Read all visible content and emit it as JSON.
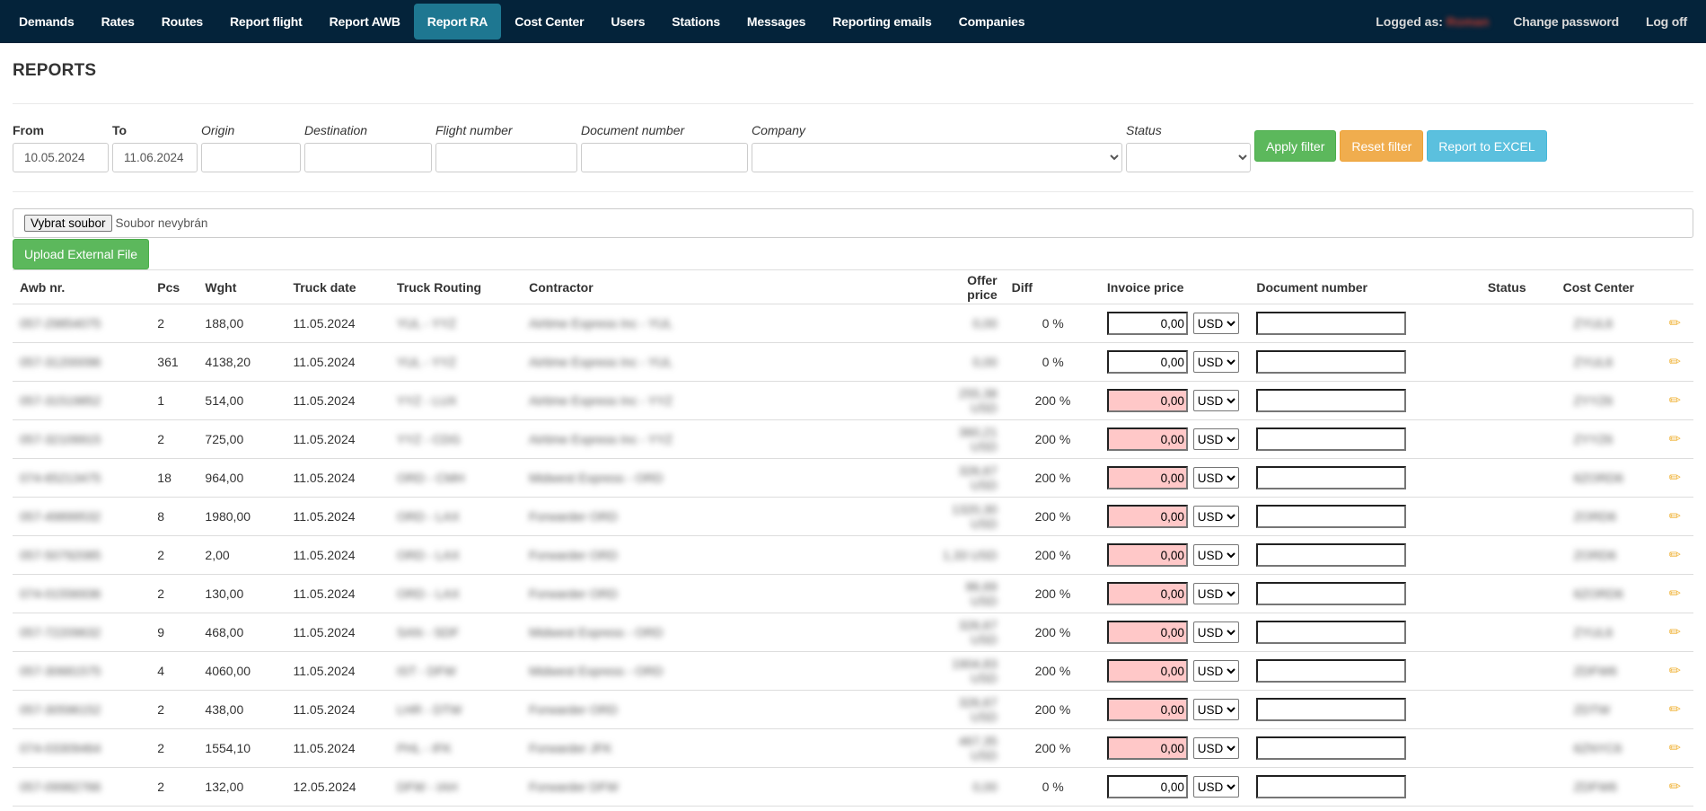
{
  "nav": {
    "items": [
      {
        "label": "Demands",
        "active": false
      },
      {
        "label": "Rates",
        "active": false
      },
      {
        "label": "Routes",
        "active": false
      },
      {
        "label": "Report flight",
        "active": false
      },
      {
        "label": "Report AWB",
        "active": false
      },
      {
        "label": "Report RA",
        "active": true
      },
      {
        "label": "Cost Center",
        "active": false
      },
      {
        "label": "Users",
        "active": false
      },
      {
        "label": "Stations",
        "active": false
      },
      {
        "label": "Messages",
        "active": false
      },
      {
        "label": "Reporting emails",
        "active": false
      },
      {
        "label": "Companies",
        "active": false
      }
    ],
    "logged_as_label": "Logged as:",
    "user_name": "Roman",
    "change_password": "Change password",
    "log_off": "Log off",
    "bg_color": "#04233a",
    "active_color": "#1e7791"
  },
  "page_title": "REPORTS",
  "filters": {
    "from_label": "From",
    "from_value": "10.05.2024",
    "to_label": "To",
    "to_value": "11.06.2024",
    "origin_label": "Origin",
    "origin_value": "",
    "destination_label": "Destination",
    "destination_value": "",
    "flight_label": "Flight number",
    "flight_value": "",
    "document_label": "Document number",
    "document_value": "",
    "company_label": "Company",
    "company_value": "",
    "status_label": "Status",
    "status_value": "",
    "apply": "Apply filter",
    "reset": "Reset filter",
    "excel": "Report to EXCEL"
  },
  "upload": {
    "choose_file": "Vybrat soubor",
    "no_file": "Soubor nevybrán",
    "upload_button": "Upload External File"
  },
  "table": {
    "headers": [
      "Awb nr.",
      "Pcs",
      "Wght",
      "Truck date",
      "Truck Routing",
      "Contractor",
      "Offer price",
      "Diff",
      "Invoice price",
      "Document number",
      "Status",
      "Cost Center"
    ],
    "rows": [
      {
        "awb": "057-29854075",
        "pcs": "2",
        "wght": "188,00",
        "date": "11.05.2024",
        "routing": "YUL - YYZ",
        "contractor": "Airtime Express Inc - YUL",
        "offer": "0,00",
        "diff": "0 %",
        "invoice": "0,00",
        "currency": "USD",
        "doc": "",
        "status": "",
        "cost_center": "ZYUL6",
        "flag": false
      },
      {
        "awb": "057-31200096",
        "pcs": "361",
        "wght": "4138,20",
        "date": "11.05.2024",
        "routing": "YUL - YYZ",
        "contractor": "Airtime Express Inc - YUL",
        "offer": "0,00",
        "diff": "0 %",
        "invoice": "0,00",
        "currency": "USD",
        "doc": "",
        "status": "",
        "cost_center": "ZYUL6",
        "flag": false
      },
      {
        "awb": "057-31519852",
        "pcs": "1",
        "wght": "514,00",
        "date": "11.05.2024",
        "routing": "YYZ - LUX",
        "contractor": "Airtime Express Inc - YYZ",
        "offer": "255,38 USD",
        "diff": "200 %",
        "invoice": "0,00",
        "currency": "USD",
        "doc": "",
        "status": "",
        "cost_center": "ZYYZ6",
        "flag": true
      },
      {
        "awb": "057-32109915",
        "pcs": "2",
        "wght": "725,00",
        "date": "11.05.2024",
        "routing": "YYZ - CDG",
        "contractor": "Airtime Express Inc - YYZ",
        "offer": "360,21 USD",
        "diff": "200 %",
        "invoice": "0,00",
        "currency": "USD",
        "doc": "",
        "status": "",
        "cost_center": "ZYYZ6",
        "flag": true
      },
      {
        "awb": "074-65213475",
        "pcs": "18",
        "wght": "964,00",
        "date": "11.05.2024",
        "routing": "ORD - CMH",
        "contractor": "Midwest Express - ORD",
        "offer": "326,67 USD",
        "diff": "200 %",
        "invoice": "0,00",
        "currency": "USD",
        "doc": "",
        "status": "",
        "cost_center": "6ZORD6",
        "flag": true
      },
      {
        "awb": "057-49899532",
        "pcs": "8",
        "wght": "1980,00",
        "date": "11.05.2024",
        "routing": "ORD - LAX",
        "contractor": "Forwarder ORD",
        "offer": "1320,30 USD",
        "diff": "200 %",
        "invoice": "0,00",
        "currency": "USD",
        "doc": "",
        "status": "",
        "cost_center": "ZORD6",
        "flag": true
      },
      {
        "awb": "057-50792085",
        "pcs": "2",
        "wght": "2,00",
        "date": "11.05.2024",
        "routing": "ORD - LAX",
        "contractor": "Forwarder ORD",
        "offer": "1,33 USD",
        "diff": "200 %",
        "invoice": "0,00",
        "currency": "USD",
        "doc": "",
        "status": "",
        "cost_center": "ZORD6",
        "flag": true
      },
      {
        "awb": "074-01556936",
        "pcs": "2",
        "wght": "130,00",
        "date": "11.05.2024",
        "routing": "ORD - LAX",
        "contractor": "Forwarder ORD",
        "offer": "86,69 USD",
        "diff": "200 %",
        "invoice": "0,00",
        "currency": "USD",
        "doc": "",
        "status": "",
        "cost_center": "6ZORD6",
        "flag": true
      },
      {
        "awb": "057-72209632",
        "pcs": "9",
        "wght": "468,00",
        "date": "11.05.2024",
        "routing": "SAN - SDF",
        "contractor": "Midwest Express - ORD",
        "offer": "326,67 USD",
        "diff": "200 %",
        "invoice": "0,00",
        "currency": "USD",
        "doc": "",
        "status": "",
        "cost_center": "ZYUL6",
        "flag": true
      },
      {
        "awb": "057-30681575",
        "pcs": "4",
        "wght": "4060,00",
        "date": "11.05.2024",
        "routing": "IST - DFW",
        "contractor": "Midwest Express - ORD",
        "offer": "1904,83 USD",
        "diff": "200 %",
        "invoice": "0,00",
        "currency": "USD",
        "doc": "",
        "status": "",
        "cost_center": "ZDFW6",
        "flag": true
      },
      {
        "awb": "057-30596152",
        "pcs": "2",
        "wght": "438,00",
        "date": "11.05.2024",
        "routing": "LHR - DTW",
        "contractor": "Forwarder ORD",
        "offer": "326,67 USD",
        "diff": "200 %",
        "invoice": "0,00",
        "currency": "USD",
        "doc": "",
        "status": "",
        "cost_center": "ZDTW",
        "flag": true
      },
      {
        "awb": "074-03309464",
        "pcs": "2",
        "wght": "1554,10",
        "date": "11.05.2024",
        "routing": "PHL - IFK",
        "contractor": "Forwarder JFK",
        "offer": "467,35 USD",
        "diff": "200 %",
        "invoice": "0,00",
        "currency": "USD",
        "doc": "",
        "status": "",
        "cost_center": "6ZNYC6",
        "flag": true
      },
      {
        "awb": "057-09982766",
        "pcs": "2",
        "wght": "132,00",
        "date": "12.05.2024",
        "routing": "DFW - IAH",
        "contractor": "Forwarder DFW",
        "offer": "0,00",
        "diff": "0 %",
        "invoice": "0,00",
        "currency": "USD",
        "doc": "",
        "status": "",
        "cost_center": "ZDFW6",
        "flag": false
      }
    ],
    "edit_icon": "pencil-icon",
    "flag_color": "#ffc8c8"
  }
}
